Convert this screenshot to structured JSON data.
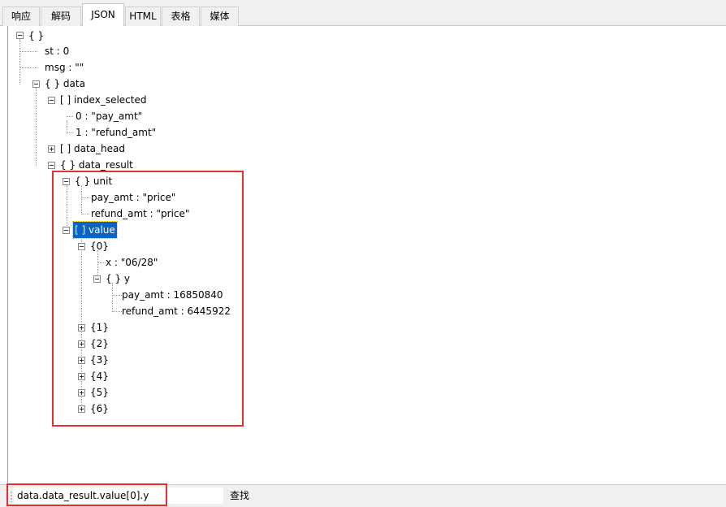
{
  "tabs": [
    {
      "label": "响应",
      "active": false
    },
    {
      "label": "解码",
      "active": false
    },
    {
      "label": "JSON",
      "active": true
    },
    {
      "label": "HTML",
      "active": false
    },
    {
      "label": "表格",
      "active": false
    },
    {
      "label": "媒体",
      "active": false
    }
  ],
  "tree": {
    "root": "{ }",
    "st": "st : 0",
    "msg": "msg : \"\"",
    "data": "{ } data",
    "index_selected": "[ ] index_selected",
    "index_selected_0": "0 : \"pay_amt\"",
    "index_selected_1": "1 : \"refund_amt\"",
    "data_head": "[ ] data_head",
    "data_result": "{ } data_result",
    "unit": "{ } unit",
    "unit_pay_amt": "pay_amt : \"price\"",
    "unit_refund_amt": "refund_amt : \"price\"",
    "value": "[ ] value",
    "v0": "{0}",
    "v0_x": "x : \"06/28\"",
    "v0_y": "{ } y",
    "v0_y_pay_amt": "pay_amt : 16850840",
    "v0_y_refund_amt": "refund_amt : 6445922",
    "v1": "{1}",
    "v2": "{2}",
    "v3": "{3}",
    "v4": "{4}",
    "v5": "{5}",
    "v6": "{6}"
  },
  "bottom": {
    "path": "data.data_result.value[0].y",
    "find_label": "查找"
  },
  "colors": {
    "selection": "#0a64c8",
    "highlight_box": "#e03030"
  }
}
